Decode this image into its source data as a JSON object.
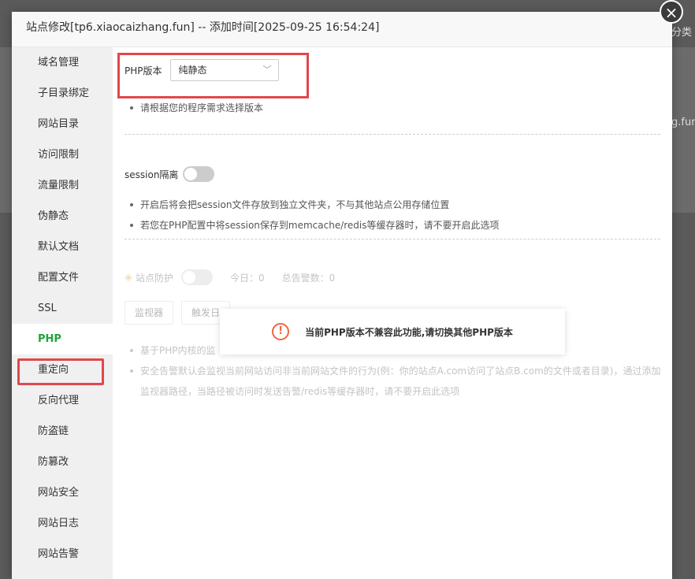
{
  "background": {
    "right_text_1": "分类",
    "right_text_2": "g.fun"
  },
  "modal": {
    "title": "站点修改[tp6.xiaocaizhang.fun] -- 添加时间[2025-09-25 16:54:24]",
    "close_icon": "close-icon"
  },
  "sidebar": {
    "items": [
      {
        "label": "域名管理"
      },
      {
        "label": "子目录绑定"
      },
      {
        "label": "网站目录"
      },
      {
        "label": "访问限制"
      },
      {
        "label": "流量限制"
      },
      {
        "label": "伪静态"
      },
      {
        "label": "默认文档"
      },
      {
        "label": "配置文件"
      },
      {
        "label": "SSL"
      },
      {
        "label": "PHP"
      },
      {
        "label": "重定向"
      },
      {
        "label": "反向代理"
      },
      {
        "label": "防盗链"
      },
      {
        "label": "防篡改"
      },
      {
        "label": "网站安全"
      },
      {
        "label": "网站日志"
      },
      {
        "label": "网站告警"
      }
    ],
    "active": "PHP"
  },
  "php": {
    "label": "PHP版本",
    "selected": "纯静态",
    "tip": "请根据您的程序需求选择版本"
  },
  "session": {
    "label": "session隔离",
    "enabled": false,
    "tips": [
      "开启后将会把session文件存放到独立文件夹，不与其他站点公用存储位置",
      "若您在PHP配置中将session保存到memcache/redis等缓存器时，请不要开启此选项"
    ]
  },
  "protection": {
    "label": "站点防护",
    "enabled": false,
    "today": "今日：0",
    "total": "总告警数：0",
    "buttons": [
      "监视器",
      "触发日"
    ],
    "tips": [
      "基于PHP内核的监",
      "安全告警默认会监视当前网站访问非当前网站文件的行为(例：你的站点A.com访问了站点B.com的文件或者目录)，通过添加监视器路径，当路径被访问时发送告警/redis等缓存器时，请不要开启此选项"
    ]
  },
  "toast": {
    "icon": "warning-icon",
    "message": "当前PHP版本不兼容此功能,请切换其他PHP版本",
    "color": "#f0663e"
  },
  "colors": {
    "active": "#20a53a",
    "highlight_border": "#e0474c"
  }
}
